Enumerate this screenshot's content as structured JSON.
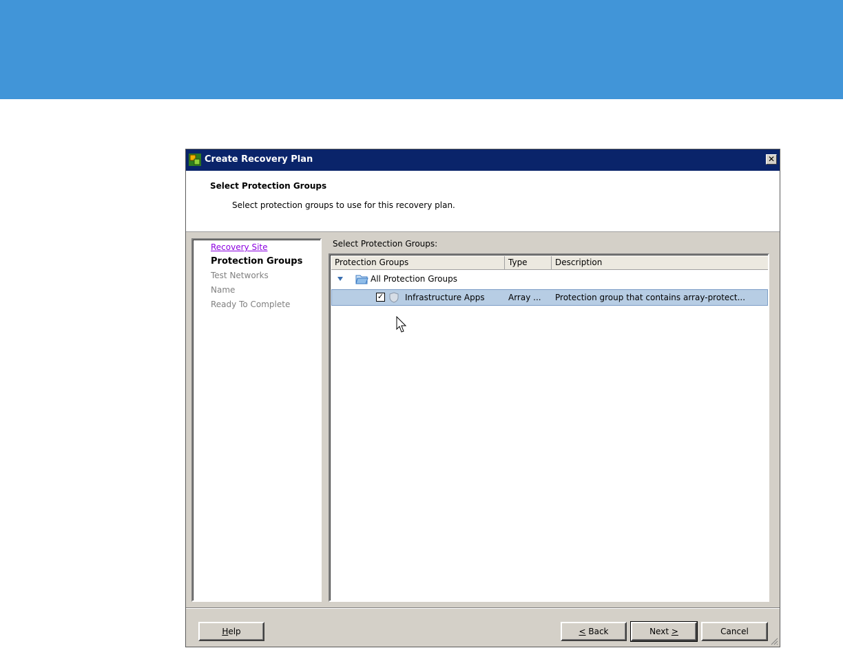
{
  "window": {
    "title": "Create Recovery Plan",
    "close_glyph": "✕"
  },
  "header": {
    "title": "Select Protection Groups",
    "description": "Select protection groups to use for this recovery plan."
  },
  "steps": [
    {
      "label": "Recovery Site",
      "state": "visited"
    },
    {
      "label": "Protection Groups",
      "state": "current"
    },
    {
      "label": "Test Networks",
      "state": "pending"
    },
    {
      "label": "Name",
      "state": "pending"
    },
    {
      "label": "Ready To Complete",
      "state": "pending"
    }
  ],
  "list": {
    "label": "Select Protection Groups:",
    "columns": [
      "Protection Groups",
      "Type",
      "Description"
    ],
    "root": {
      "label": "All Protection Groups",
      "icon": "folder-icon",
      "expanded": true
    },
    "rows": [
      {
        "checked": true,
        "check_glyph": "✓",
        "icon": "shield-icon",
        "name": "Infrastructure Apps",
        "type": "Array ...",
        "description": "Protection group that contains array-protect..."
      }
    ]
  },
  "buttons": {
    "help": {
      "mnemonic": "H",
      "rest": "elp"
    },
    "back": {
      "mnemonic": "<",
      "rest": " Back"
    },
    "next": {
      "prefix": "Next ",
      "mnemonic": ">"
    },
    "cancel": "Cancel"
  },
  "colors": {
    "banner": "#4195d8",
    "titlebar": "#0a246a",
    "selection": "#b7cde4",
    "link_visited": "#8b00e0"
  }
}
